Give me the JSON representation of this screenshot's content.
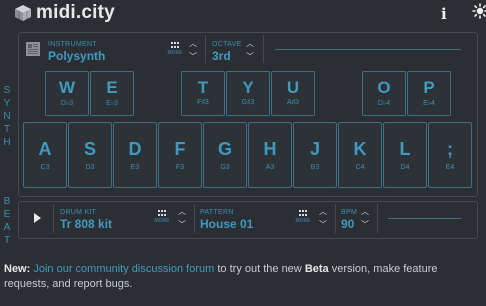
{
  "header": {
    "app_name": "midi.city",
    "info_label": "i"
  },
  "side_labels": {
    "synth": [
      "S",
      "Y",
      "N",
      "T",
      "H"
    ],
    "beat": [
      "B",
      "E",
      "A",
      "T"
    ]
  },
  "synth": {
    "instrument": {
      "label": "INSTRUMENT",
      "value": "Polysynth",
      "more": "MORE"
    },
    "octave": {
      "label": "OCTAVE",
      "value": "3rd"
    },
    "top_keys": [
      {
        "letter": "W",
        "note": "D♭3"
      },
      {
        "letter": "E",
        "note": "E♭3"
      },
      {
        "letter": "T",
        "note": "F♯3"
      },
      {
        "letter": "Y",
        "note": "G♯3"
      },
      {
        "letter": "U",
        "note": "A♯3"
      },
      {
        "letter": "O",
        "note": "D♭4"
      },
      {
        "letter": "P",
        "note": "E♭4"
      }
    ],
    "bottom_keys": [
      {
        "letter": "A",
        "note": "C3"
      },
      {
        "letter": "S",
        "note": "D3"
      },
      {
        "letter": "D",
        "note": "E3"
      },
      {
        "letter": "F",
        "note": "F3"
      },
      {
        "letter": "G",
        "note": "G3"
      },
      {
        "letter": "H",
        "note": "A3"
      },
      {
        "letter": "J",
        "note": "B3"
      },
      {
        "letter": "K",
        "note": "C4"
      },
      {
        "letter": "L",
        "note": "D4"
      },
      {
        "letter": ";",
        "note": "E4"
      }
    ]
  },
  "beat": {
    "drum_kit": {
      "label": "DRUM KIT",
      "value": "Tr 808 kit",
      "more": "MORE"
    },
    "pattern": {
      "label": "PATTERN",
      "value": "House 01",
      "more": "MORE"
    },
    "bpm": {
      "label": "BPM",
      "value": "90"
    }
  },
  "footer": {
    "prefix": "New:",
    "link_text": "Join our community discussion forum",
    "middle": " to try out the new ",
    "beta": "Beta",
    "suffix": " version, make feature requests, and report bugs."
  },
  "colors": {
    "accent": "#3f9ac2",
    "background": "#2b2f33",
    "border": "#424a52",
    "key_border": "#3d6f89"
  }
}
